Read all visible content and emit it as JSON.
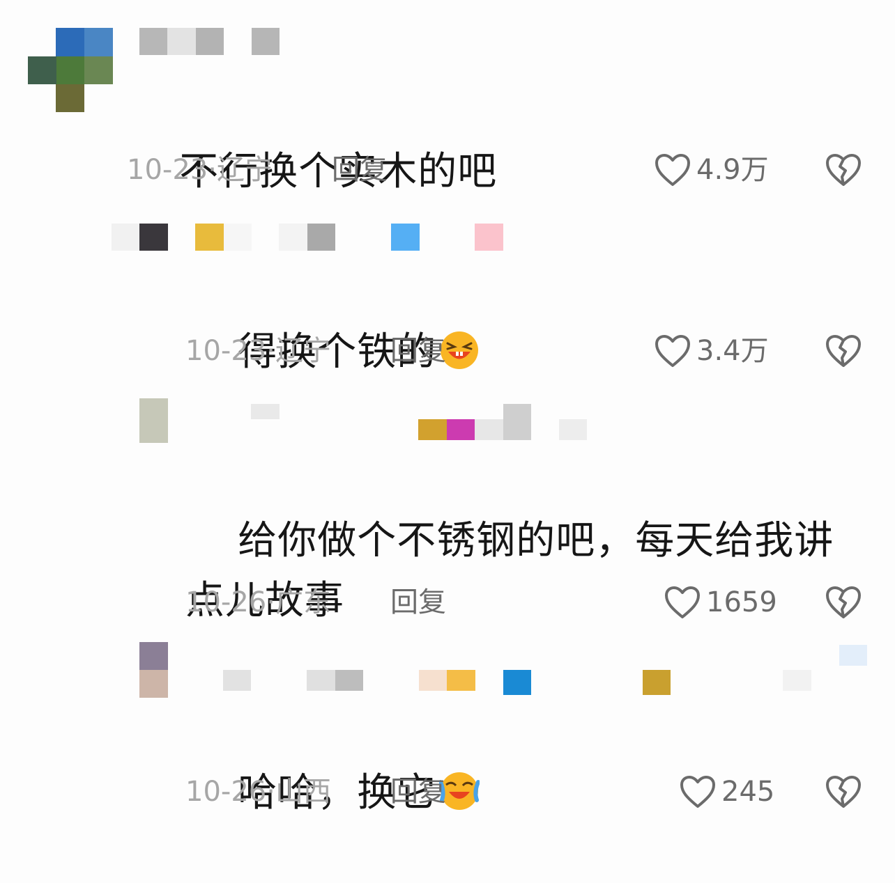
{
  "comments": [
    {
      "text": "不行换个实木的吧",
      "date": "10-23",
      "location": "辽宁",
      "reply_label": "回复",
      "likes": "4.9万",
      "emoji": ""
    },
    {
      "text": "得换个铁的",
      "date": "10-23",
      "location": "辽宁",
      "reply_label": "回复",
      "likes": "3.4万",
      "emoji": "laughing-emoji"
    },
    {
      "text": "给你做个不锈钢的吧，每天给我讲点儿故事",
      "date": "10-26",
      "location": "广东",
      "reply_label": "回复",
      "likes": "1659",
      "emoji": ""
    },
    {
      "text": "哈哈，换它",
      "date": "10-26",
      "location": "山西",
      "reply_label": "回复",
      "likes": "245",
      "emoji": "rofl-emoji"
    }
  ],
  "meta_separator": "·",
  "icons": {
    "like": "heart-icon",
    "dislike": "broken-heart-icon"
  },
  "colors": {
    "text": "#161616",
    "meta": "#a6a6a6",
    "action": "#6b6b6b"
  }
}
